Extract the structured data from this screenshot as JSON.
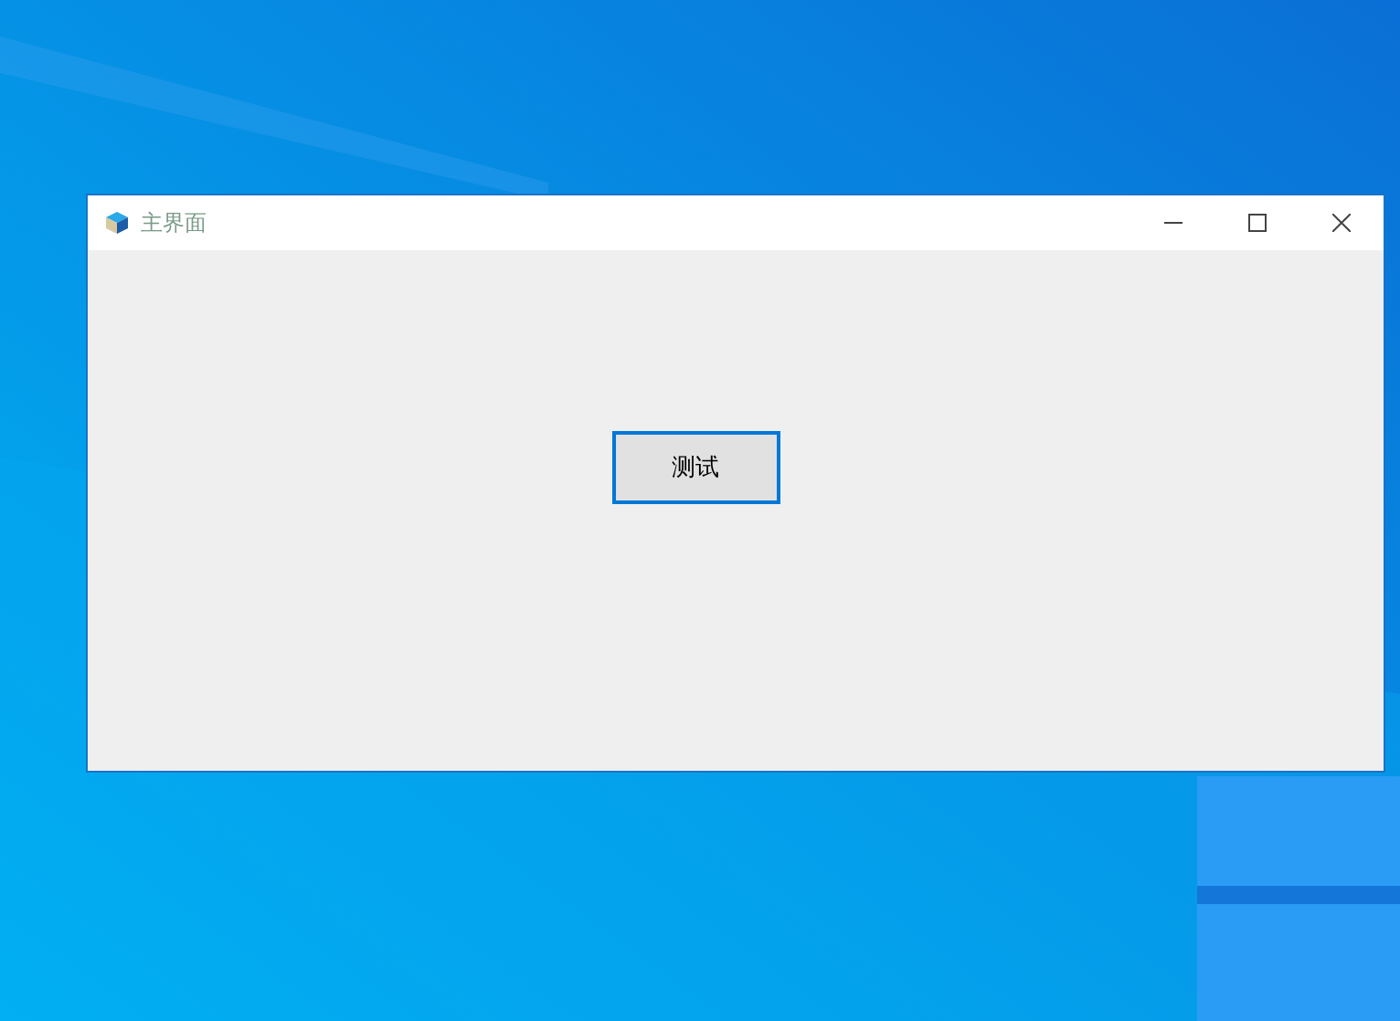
{
  "window": {
    "title": "主界面"
  },
  "button": {
    "label": "测试",
    "focused": true
  }
}
